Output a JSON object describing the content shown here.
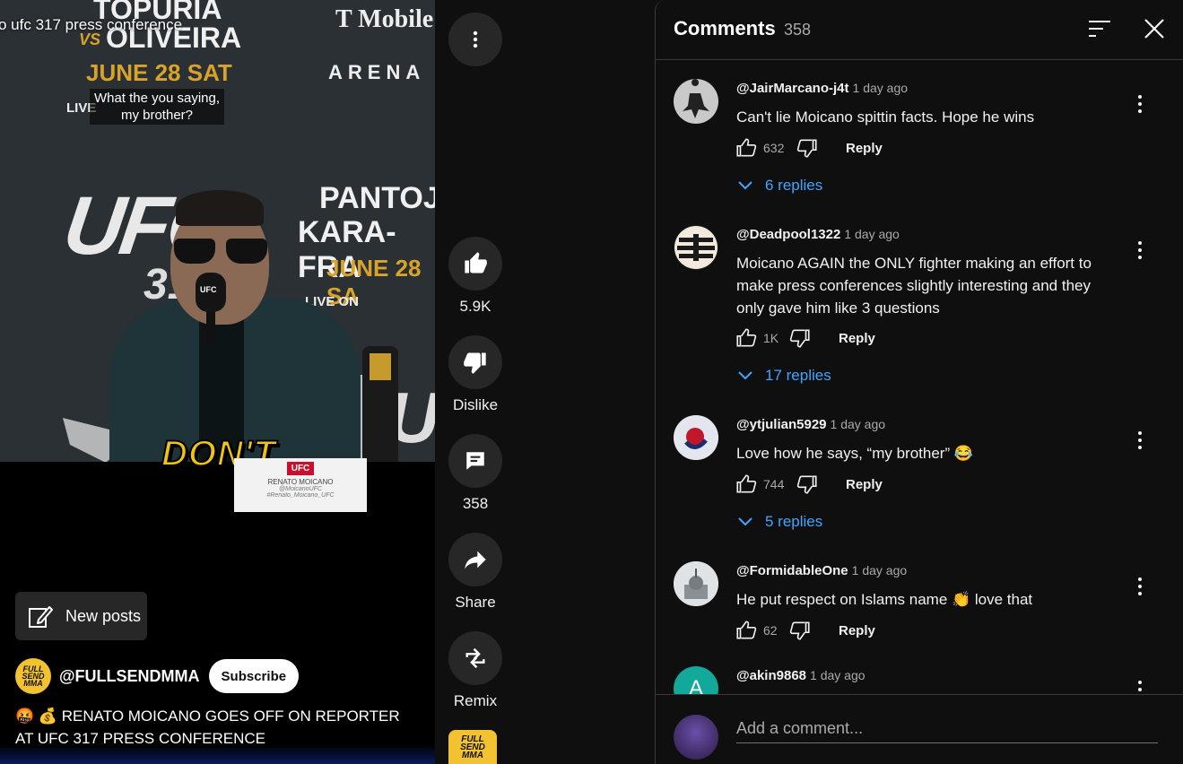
{
  "video": {
    "overlay_title": "o ufc 317 press conference",
    "subtitle": "What the you saying, my brother?",
    "caption_word": "DON'T",
    "poster_left": {
      "line1": "TOPURIA",
      "vs": "VS",
      "line2": "OLIVEIRA",
      "date": "JUNE 28 SAT",
      "live": "LIVE"
    },
    "poster_right": {
      "brand": "T Mobile",
      "arena": "ARENA",
      "line1": "PANTOJA",
      "line2": "KARA-FRA",
      "date": "JUNE 28 SA",
      "live": "LIVE ON"
    },
    "backdrop_text": {
      "ufc": "UFC",
      "num": "31",
      "ufc_right": "UF"
    },
    "mic_logo": "UFC",
    "name_card": {
      "tag": "UFC",
      "name": "RENATO MOICANO",
      "handle": "@MoicanoUFC",
      "hashtag": "#Renato_Moicano_UFC"
    },
    "new_posts_label": "New posts",
    "channel_handle": "@FULLSENDMMA",
    "channel_logo": "FULL SEND MMA",
    "subscribe_label": "Subscribe",
    "title": "🤬 💰 RENATO MOICANO GOES OFF ON REPORTER AT UFC 317 PRESS CONFERENCE"
  },
  "rail": {
    "like_count": "5.9K",
    "dislike_label": "Dislike",
    "comment_count": "358",
    "share_label": "Share",
    "remix_label": "Remix",
    "thumb_logo": "FULL SEND MMA"
  },
  "comments_panel": {
    "title": "Comments",
    "count": "358",
    "add_placeholder": "Add a comment...",
    "comments": [
      {
        "author": "@JairMarcano-j4t",
        "time": "1 day ago",
        "text": "Can't lie Moicano spittin facts. Hope he wins",
        "likes": "632",
        "reply_label": "Reply",
        "replies": "6 replies"
      },
      {
        "author": "@Deadpool1322",
        "time": "1 day ago",
        "text": "Moicano AGAIN the ONLY fighter making an effort to make press conferences slightly interesting and they only gave him like 3 questions",
        "likes": "1K",
        "reply_label": "Reply",
        "replies": "17 replies"
      },
      {
        "author": "@ytjulian5929",
        "time": "1 day ago",
        "text": "Love how he says, “my brother” 😂",
        "likes": "744",
        "reply_label": "Reply",
        "replies": "5 replies"
      },
      {
        "author": "@FormidableOne",
        "time": "1 day ago",
        "text": "He put respect on Islams name 👏 love that",
        "likes": "62",
        "reply_label": "Reply"
      },
      {
        "author": "@akin9868",
        "time": "1 day ago",
        "avatar_letter": "A"
      }
    ]
  },
  "colors": {
    "link": "#3ea6ff",
    "panel_bg": "#0f0f0f",
    "button_bg": "#272727",
    "accent_gold": "#d9a32a"
  }
}
